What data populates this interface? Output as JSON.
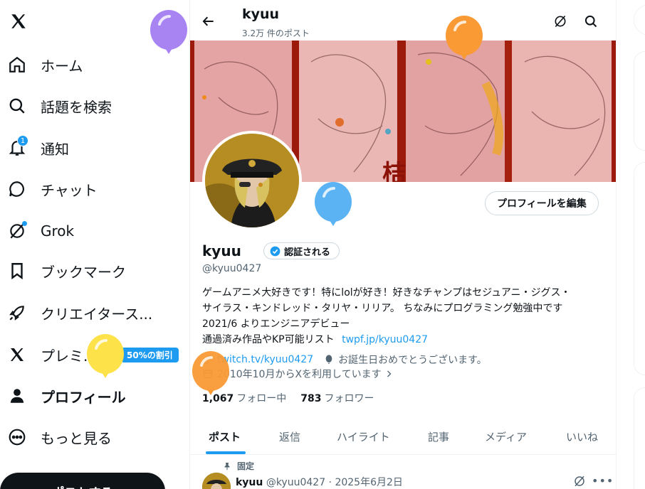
{
  "sidebar": {
    "items": [
      {
        "label": "ホーム",
        "icon": "home-icon"
      },
      {
        "label": "話題を検索",
        "icon": "search-icon"
      },
      {
        "label": "通知",
        "icon": "bell-icon",
        "badge": "1"
      },
      {
        "label": "チャット",
        "icon": "chat-icon"
      },
      {
        "label": "Grok",
        "icon": "grok-icon"
      },
      {
        "label": "ブックマーク",
        "icon": "bookmark-icon"
      },
      {
        "label": "クリエイタース...",
        "icon": "rocket-icon"
      },
      {
        "label": "プレミ...",
        "icon": "x-logo-icon",
        "discount": "50%の割引"
      },
      {
        "label": "プロフィール",
        "icon": "person-icon"
      },
      {
        "label": "もっと見る",
        "icon": "more-circle-icon"
      }
    ],
    "post_button": "ポストする"
  },
  "header": {
    "name": "kyuu",
    "post_count": "3.2万 件のポスト"
  },
  "profile": {
    "edit_button": "プロフィールを編集",
    "display_name": "kyuu",
    "verified_label": "認証される",
    "handle": "@kyuu0427",
    "bio": {
      "line1": "ゲームアニメ大好きです！特にlolが好き！好きなチャンプはセジュアニ・ジグス・",
      "line2": "サイラス・キンドレッド・タリヤ・リリア。 ちなみにプログラミング勉強中です",
      "line3": "2021/6 よりエンジニアデビュー",
      "line4_text": "通過済み作品やKP可能リスト",
      "line4_link": "twpf.jp/kyuu0427"
    },
    "website": "twitch.tv/kyuu0427",
    "birthday": "お誕生日おめでとうございます。",
    "joined": "2010年10月からXを利用しています",
    "following_count": "1,067",
    "following_label": "フォロー中",
    "followers_count": "783",
    "followers_label": "フォロワー"
  },
  "tabs": [
    "ポスト",
    "返信",
    "ハイライト",
    "記事",
    "メディア",
    "いいね"
  ],
  "pinned_tweet": {
    "pinned_label": "固定",
    "name": "kyuu",
    "meta": "@kyuu0427 · 2025年6月2日"
  },
  "colors": {
    "accent": "#1d9bf0",
    "banner_bg": "#e5a8a8"
  }
}
